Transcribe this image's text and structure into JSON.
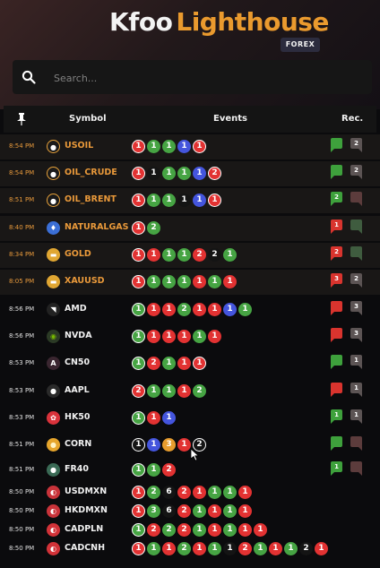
{
  "app": {
    "title_part1": "Kfoo",
    "title_part2": "Lighthouse",
    "badge": "FOREX"
  },
  "search": {
    "placeholder": "Search..."
  },
  "columns": {
    "symbol": "Symbol",
    "events": "Events",
    "rec": "Rec."
  },
  "rows": [
    {
      "time": "8:54 PM",
      "symbol": "USOIL",
      "highlight": true,
      "icon": "drop-icon",
      "events": [
        [
          "r",
          "1",
          true
        ],
        [
          "g",
          "1"
        ],
        [
          "g",
          "1"
        ],
        [
          "b",
          "1"
        ],
        [
          "r",
          "1",
          true
        ]
      ],
      "rec": {
        "left": [
          "green",
          ""
        ],
        "right": [
          "grey",
          "2"
        ]
      }
    },
    {
      "time": "8:54 PM",
      "symbol": "OIL_CRUDE",
      "highlight": true,
      "icon": "drop-icon",
      "events": [
        [
          "r",
          "1",
          true
        ],
        [
          "k",
          "1"
        ],
        [
          "g",
          "1"
        ],
        [
          "g",
          "1"
        ],
        [
          "b",
          "1"
        ],
        [
          "r",
          "2",
          true
        ]
      ],
      "rec": {
        "left": [
          "green",
          ""
        ],
        "right": [
          "grey",
          "2"
        ]
      }
    },
    {
      "time": "8:51 PM",
      "symbol": "OIL_BRENT",
      "highlight": true,
      "icon": "drop-icon",
      "events": [
        [
          "r",
          "1",
          true
        ],
        [
          "g",
          "1"
        ],
        [
          "g",
          "1"
        ],
        [
          "k",
          "1"
        ],
        [
          "b",
          "1"
        ],
        [
          "r",
          "1",
          true
        ]
      ],
      "rec": {
        "left": [
          "green",
          "2"
        ],
        "right": [
          "dred",
          ""
        ]
      }
    },
    {
      "time": "8:40 PM",
      "symbol": "NATURALGAS",
      "highlight": true,
      "icon": "flame-icon",
      "events": [
        [
          "r",
          "1",
          true
        ],
        [
          "g",
          "2"
        ]
      ],
      "rec": {
        "left": [
          "red",
          "1"
        ],
        "right": [
          "dgreen",
          ""
        ]
      }
    },
    {
      "time": "8:34 PM",
      "symbol": "GOLD",
      "highlight": true,
      "icon": "gold-bars-icon",
      "events": [
        [
          "r",
          "1",
          true
        ],
        [
          "r",
          "1"
        ],
        [
          "g",
          "1"
        ],
        [
          "g",
          "1"
        ],
        [
          "r",
          "2"
        ],
        [
          "k",
          "2"
        ],
        [
          "g",
          "1"
        ]
      ],
      "rec": {
        "left": [
          "red",
          "2"
        ],
        "right": [
          "dgreen",
          ""
        ]
      }
    },
    {
      "time": "8:05 PM",
      "symbol": "XAUUSD",
      "highlight": true,
      "icon": "gold-bars-icon",
      "events": [
        [
          "r",
          "1",
          true
        ],
        [
          "g",
          "1"
        ],
        [
          "g",
          "1"
        ],
        [
          "g",
          "1"
        ],
        [
          "r",
          "1"
        ],
        [
          "g",
          "1"
        ],
        [
          "r",
          "1"
        ]
      ],
      "rec": {
        "left": [
          "red",
          "3"
        ],
        "right": [
          "grey",
          "2"
        ]
      }
    },
    {
      "time": "8:56 PM",
      "symbol": "AMD",
      "highlight": false,
      "icon": "amd-icon",
      "events": [
        [
          "g",
          "1",
          true
        ],
        [
          "r",
          "1"
        ],
        [
          "r",
          "1"
        ],
        [
          "g",
          "2"
        ],
        [
          "r",
          "1"
        ],
        [
          "r",
          "1"
        ],
        [
          "b",
          "1"
        ],
        [
          "g",
          "1"
        ]
      ],
      "rec": {
        "left": [
          "red",
          ""
        ],
        "right": [
          "grey",
          "3"
        ]
      }
    },
    {
      "time": "8:56 PM",
      "symbol": "NVDA",
      "highlight": false,
      "icon": "nvidia-icon",
      "events": [
        [
          "g",
          "1",
          true
        ],
        [
          "r",
          "1"
        ],
        [
          "r",
          "1"
        ],
        [
          "r",
          "1"
        ],
        [
          "g",
          "1"
        ],
        [
          "r",
          "1"
        ]
      ],
      "rec": {
        "left": [
          "red",
          ""
        ],
        "right": [
          "grey",
          "3"
        ]
      }
    },
    {
      "time": "8:53 PM",
      "symbol": "CN50",
      "highlight": false,
      "icon": "a50-icon",
      "events": [
        [
          "g",
          "1",
          true
        ],
        [
          "r",
          "2"
        ],
        [
          "g",
          "1"
        ],
        [
          "r",
          "1"
        ],
        [
          "r",
          "1",
          true
        ]
      ],
      "rec": {
        "left": [
          "green",
          ""
        ],
        "right": [
          "grey",
          "1"
        ]
      }
    },
    {
      "time": "8:53 PM",
      "symbol": "AAPL",
      "highlight": false,
      "icon": "apple-icon",
      "events": [
        [
          "r",
          "2",
          true
        ],
        [
          "g",
          "1"
        ],
        [
          "g",
          "1"
        ],
        [
          "r",
          "1"
        ],
        [
          "g",
          "2"
        ]
      ],
      "rec": {
        "left": [
          "red",
          ""
        ],
        "right": [
          "grey",
          "1"
        ]
      }
    },
    {
      "time": "8:53 PM",
      "symbol": "HK50",
      "highlight": false,
      "icon": "hk-flag-icon",
      "events": [
        [
          "g",
          "1",
          true
        ],
        [
          "r",
          "1"
        ],
        [
          "b",
          "1"
        ]
      ],
      "rec": {
        "left": [
          "green",
          "1"
        ],
        "right": [
          "grey",
          "1"
        ]
      }
    },
    {
      "time": "8:51 PM",
      "symbol": "CORN",
      "highlight": false,
      "icon": "corn-icon",
      "events": [
        [
          "k",
          "1",
          true
        ],
        [
          "b",
          "1"
        ],
        [
          "o",
          "3"
        ],
        [
          "r",
          "1"
        ],
        [
          "k",
          "2",
          true
        ]
      ],
      "rec": {
        "left": [
          "green",
          ""
        ],
        "right": [
          "dred",
          ""
        ]
      }
    },
    {
      "time": "8:51 PM",
      "symbol": "FR40",
      "highlight": false,
      "icon": "fr40-icon",
      "events": [
        [
          "g",
          "1",
          true
        ],
        [
          "g",
          "1"
        ],
        [
          "r",
          "2"
        ]
      ],
      "rec": {
        "left": [
          "green",
          "1"
        ],
        "right": [
          "dred",
          ""
        ]
      }
    },
    {
      "time": "8:50 PM",
      "symbol": "USDMXN",
      "highlight": false,
      "icon": "us-mx-flags-icon",
      "events": [
        [
          "r",
          "1",
          true
        ],
        [
          "g",
          "2"
        ],
        [
          "k",
          "6"
        ],
        [
          "r",
          "2"
        ],
        [
          "r",
          "1"
        ],
        [
          "g",
          "1"
        ],
        [
          "g",
          "1"
        ],
        [
          "r",
          "1"
        ]
      ],
      "rec": null
    },
    {
      "time": "8:50 PM",
      "symbol": "HKDMXN",
      "highlight": false,
      "icon": "hk-mx-flags-icon",
      "events": [
        [
          "r",
          "1",
          true
        ],
        [
          "g",
          "3"
        ],
        [
          "k",
          "6"
        ],
        [
          "r",
          "2"
        ],
        [
          "g",
          "1"
        ],
        [
          "r",
          "1"
        ],
        [
          "g",
          "1"
        ],
        [
          "r",
          "1"
        ]
      ],
      "rec": null
    },
    {
      "time": "8:50 PM",
      "symbol": "CADPLN",
      "highlight": false,
      "icon": "ca-pl-flags-icon",
      "events": [
        [
          "g",
          "1",
          true
        ],
        [
          "r",
          "2"
        ],
        [
          "g",
          "2"
        ],
        [
          "r",
          "2"
        ],
        [
          "g",
          "1"
        ],
        [
          "r",
          "1"
        ],
        [
          "g",
          "1"
        ],
        [
          "r",
          "1"
        ],
        [
          "r",
          "1"
        ]
      ],
      "rec": null
    },
    {
      "time": "8:50 PM",
      "symbol": "CADCNH",
      "highlight": false,
      "icon": "ca-cn-flags-icon",
      "events": [
        [
          "r",
          "1",
          true
        ],
        [
          "g",
          "1"
        ],
        [
          "r",
          "1"
        ],
        [
          "g",
          "2"
        ],
        [
          "r",
          "1"
        ],
        [
          "g",
          "1"
        ],
        [
          "k",
          "1"
        ],
        [
          "r",
          "2"
        ],
        [
          "g",
          "1"
        ],
        [
          "r",
          "1"
        ],
        [
          "g",
          "1"
        ],
        [
          "k",
          "2"
        ],
        [
          "r",
          "1"
        ]
      ],
      "rec": null
    }
  ],
  "colors": {
    "accent": "#e9993a",
    "red": "#e23232",
    "green": "#46a443",
    "blue": "#4455dd"
  }
}
